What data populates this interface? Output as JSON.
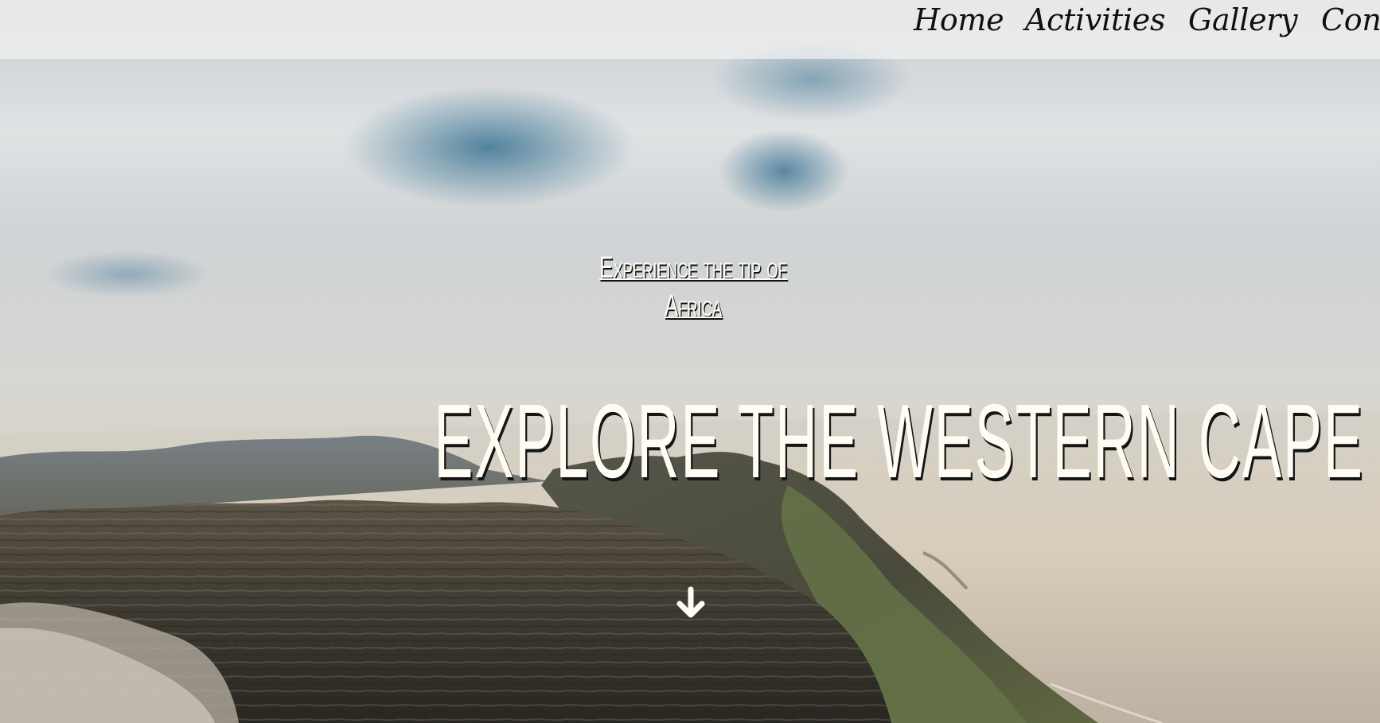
{
  "navigation": {
    "home_label": "Home",
    "activities_label": "Activities",
    "gallery_label": "Gallery",
    "contact_label": "Cont"
  },
  "hero": {
    "eyebrow": "Experience the tip of Africa",
    "headline": "EXPLORE THE WESTERN CAPE",
    "scroll_icon": "arrow-down"
  },
  "colors": {
    "text": "#fffdf3",
    "shadow": "#151515",
    "nav_background": "#f2f2f2",
    "sea_glow": "#fff6e0",
    "cliff_dark": "#3f3a31",
    "vegetation": "#59653c"
  }
}
